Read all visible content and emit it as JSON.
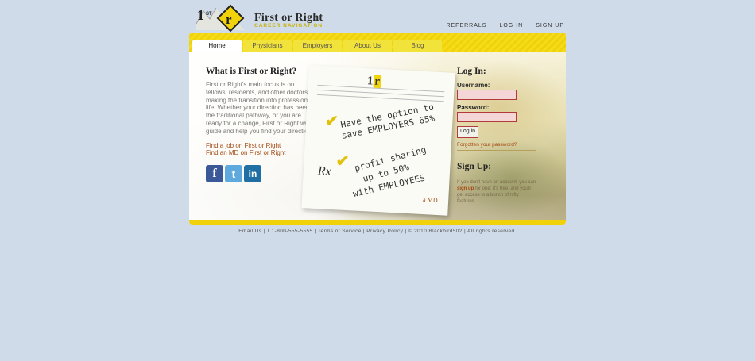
{
  "brand": {
    "title": "First or Right",
    "subtitle": "CAREER NAVIGATION"
  },
  "top_links": [
    "REFERRALS",
    "LOG IN",
    "SIGN UP"
  ],
  "tabs": [
    "Home",
    "Physicians",
    "Employers",
    "About Us",
    "Blog"
  ],
  "main": {
    "heading": "What is First or Right?",
    "intro": "First or Right's main focus is on fellows, residents, and other doctors making the transition into professional life. Whether your direction has been the traditional pathway, or you are ready for a change, First or Right will guide and help you find your direction.",
    "link_job": "Find a job on First or Right",
    "link_md": "Find an MD on First or Right"
  },
  "rx_note": {
    "line1": "Have the option to",
    "line2": "save EMPLOYERS 65%",
    "line3": "profit sharing",
    "line4": "up to 50%",
    "line5": "with EMPLOYEES",
    "symbol": "Rx",
    "signature": "a MD"
  },
  "login": {
    "heading": "Log In:",
    "username_label": "Username:",
    "password_label": "Password:",
    "button": "Log in",
    "forgot": "Forgotten your password?"
  },
  "signup": {
    "heading": "Sign Up:",
    "text_before": "If you don't have an account, you can",
    "link": "sign up",
    "text_after": "for one; it's free, and you'll get access to a bunch of nifty features."
  },
  "footer": "Email Us | T.1-800-555-5555 | Terms of Service | Privacy Policy | © 2010 Blackbird502 | All rights reserved.",
  "colors": {
    "accent_yellow": "#f1d20a",
    "link_brown": "#a44812",
    "page_bg": "#cfdbe8"
  }
}
